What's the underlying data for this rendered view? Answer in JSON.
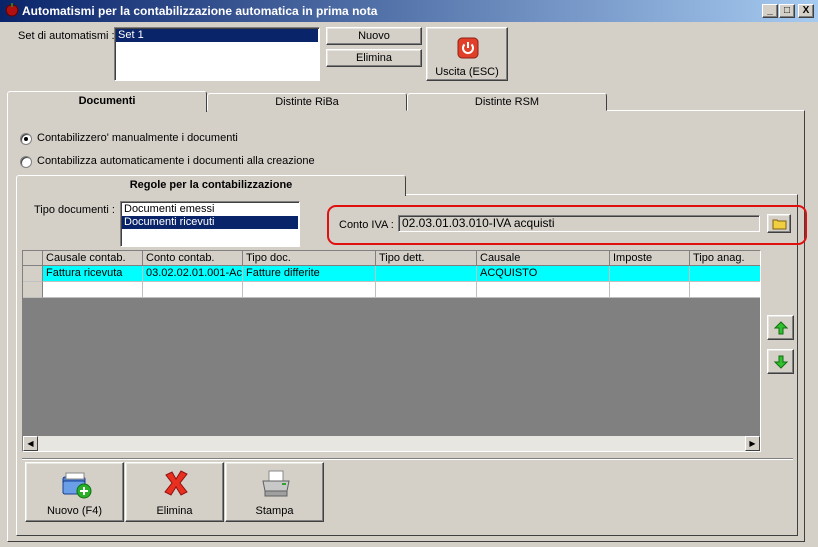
{
  "window": {
    "title": "Automatismi per la contabilizzazione automatica in prima nota",
    "controls": {
      "minimize": "_",
      "maximize": "□",
      "close": "X"
    }
  },
  "set": {
    "label": "Set di automatismi :",
    "items": [
      "Set 1"
    ],
    "new_button": "Nuovo",
    "delete_button": "Elimina",
    "exit_button": "Uscita (ESC)"
  },
  "tabs": [
    {
      "label": "Documenti",
      "active": true
    },
    {
      "label": "Distinte RiBa",
      "active": false
    },
    {
      "label": "Distinte RSM",
      "active": false
    }
  ],
  "options": {
    "manual": {
      "label": "Contabilizzero' manualmente i documenti",
      "checked": true
    },
    "automatic": {
      "label": "Contabilizza automaticamente i documenti alla creazione",
      "checked": false
    }
  },
  "rules": {
    "tab_label": "Regole per la contabilizzazione",
    "doc_type_label": "Tipo documenti :",
    "doc_types": [
      "Documenti emessi",
      "Documenti ricevuti"
    ],
    "selected_doc_type": 1,
    "conto_iva_label": "Conto IVA :",
    "conto_iva_value": "02.03.01.03.010-IVA acquisti"
  },
  "table": {
    "columns": [
      "Causale contab.",
      "Conto contab.",
      "Tipo doc.",
      "Tipo dett.",
      "Causale",
      "Imposte",
      "Tipo anag."
    ],
    "rows": [
      [
        "Fattura ricevuta",
        "03.02.02.01.001-Ac",
        "Fatture differite",
        "",
        "ACQUISTO",
        "",
        ""
      ],
      [
        "",
        "",
        "",
        "",
        "",
        "",
        ""
      ]
    ]
  },
  "bottom_buttons": {
    "new": "Nuovo (F4)",
    "delete": "Elimina",
    "print": "Stampa"
  },
  "colors": {
    "highlight_row": "#00ffff",
    "selection": "#0a246a",
    "annotation": "#e01010"
  }
}
